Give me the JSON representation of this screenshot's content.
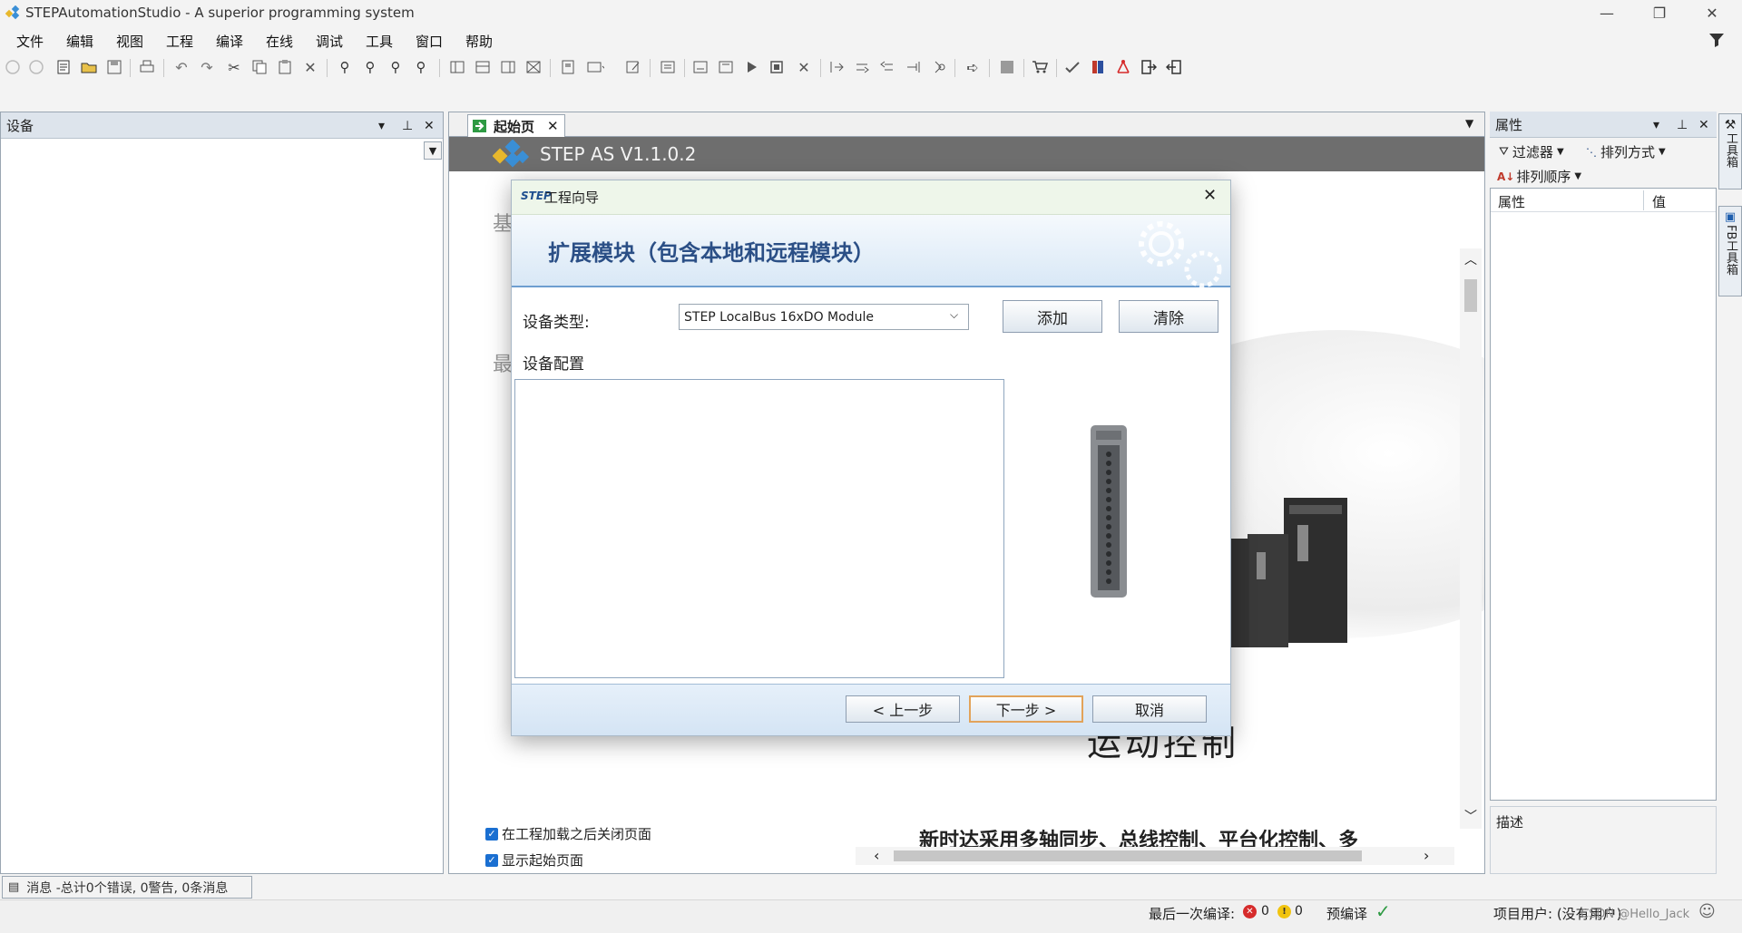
{
  "app": {
    "title": "STEPAutomationStudio - A superior programming system"
  },
  "menu": [
    "文件",
    "编辑",
    "视图",
    "工程",
    "编译",
    "在线",
    "调试",
    "工具",
    "窗口",
    "帮助"
  ],
  "device_panel": {
    "title": "设备"
  },
  "doc": {
    "tab": "起始页",
    "banner": "STEP AS V1.1.0.2",
    "bg_text_1": "基",
    "bg_text_2": "最",
    "motion_text": "运动控制",
    "slogan": "新时达采用多轴同步、总线控制、平台化控制、多",
    "checkbox1": "在工程加载之后关闭页面",
    "checkbox2": "显示起始页面"
  },
  "properties": {
    "title": "属性",
    "filter": "过滤器",
    "sort_by": "排列方式",
    "sort_order": "排列顺序",
    "col_prop": "属性",
    "col_value": "值",
    "description": "描述"
  },
  "side_tabs": {
    "toolbox": "工具箱",
    "fb_toolbox": "FB工具箱"
  },
  "messages": {
    "tab": "消息 -总计0个错误, 0警告, 0条消息"
  },
  "status": {
    "last_compile": "最后一次编译:",
    "errors": "0",
    "warnings": "0",
    "precompile": "预编译",
    "user": "项目用户: (没有用户)",
    "watermark": "CSDN @Hello_Jack"
  },
  "dialog": {
    "logo": "STEP",
    "title": "工程向导",
    "heading": "扩展模块（包含本地和远程模块）",
    "device_type_label": "设备类型:",
    "device_type_value": "STEP LocalBus 16xDO Module",
    "add": "添加",
    "clear": "清除",
    "config_label": "设备配置",
    "prev": "< 上一步",
    "next": "下一步 >",
    "cancel": "取消"
  },
  "colors": {
    "accent": "#2b4f86",
    "banner": "#6e6e6e",
    "panel_head": "#dde4ec",
    "dialog_footer": "#d4e4f4"
  }
}
